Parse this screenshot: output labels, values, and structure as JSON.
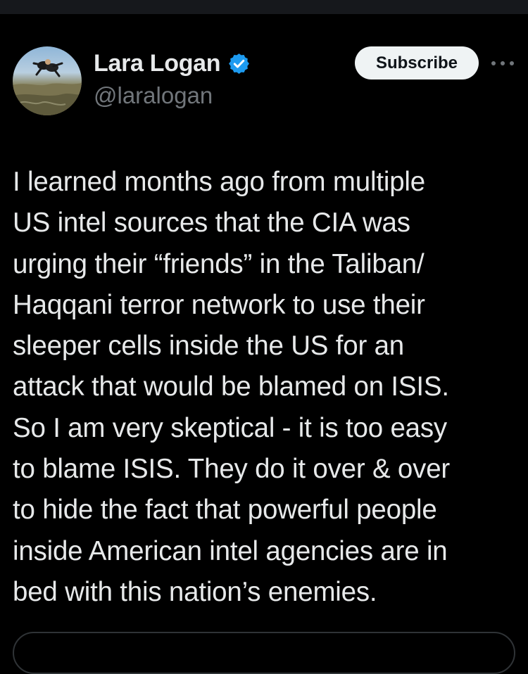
{
  "author": {
    "display_name": "Lara Logan",
    "handle": "@laralogan",
    "verified": true,
    "verified_icon": "verified-badge-icon",
    "verified_color": "#1d9bf0"
  },
  "actions": {
    "subscribe_label": "Subscribe",
    "more_icon": "more-dots-icon"
  },
  "tweet": {
    "lines": [
      "I learned months ago from multiple",
      "US intel sources that the CIA was",
      "urging their “friends” in the Taliban/",
      "Haqqani terror network to use their",
      "sleeper cells inside the US for an",
      "attack that would be blamed on ISIS.",
      "So I am very skeptical - it is too easy",
      "to blame ISIS. They do it over & over",
      "to hide the fact that powerful people",
      "inside American intel agencies are in",
      "bed with this nation’s enemies."
    ]
  },
  "colors": {
    "background": "#000000",
    "text": "#e7e9ea",
    "muted": "#71767b",
    "button_bg": "#eff3f4",
    "button_text": "#0f1419"
  }
}
